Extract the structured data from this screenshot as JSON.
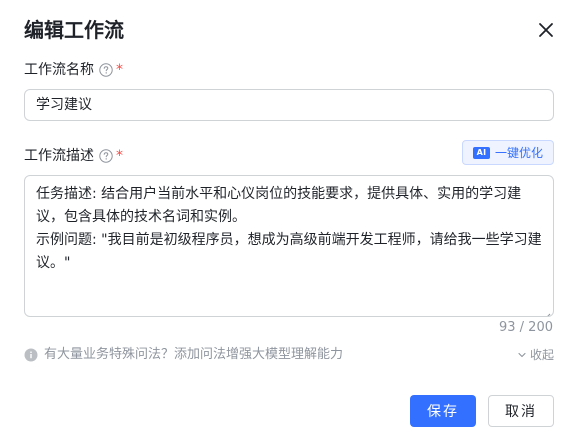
{
  "dialog": {
    "title": "编辑工作流",
    "close_icon": "close-icon"
  },
  "name_field": {
    "label": "工作流名称",
    "required_mark": "*",
    "value": "学习建议"
  },
  "desc_field": {
    "label": "工作流描述",
    "required_mark": "*",
    "ai_button": {
      "badge": "AI",
      "label": "一键优化"
    },
    "lines": [
      "任务描述: 结合用户当前水平和心仪岗位的技能要求，提供具体、实用的学习建",
      "议，包含具体的技术名词和实例。",
      "示例问题: \"我目前是初级程序员，想成为高级前端开发工程师，请给我一些学习建",
      "议。\""
    ],
    "counter": "93 / 200"
  },
  "hint": {
    "text": "有大量业务特殊问法？添加问法增强大模型理解能力",
    "collapse_label": "收起"
  },
  "footer": {
    "save_label": "保存",
    "cancel_label": "取消"
  },
  "colors": {
    "primary": "#3370ff",
    "required": "#f54a45",
    "muted": "#8f959e",
    "border": "#d0d3d6"
  }
}
